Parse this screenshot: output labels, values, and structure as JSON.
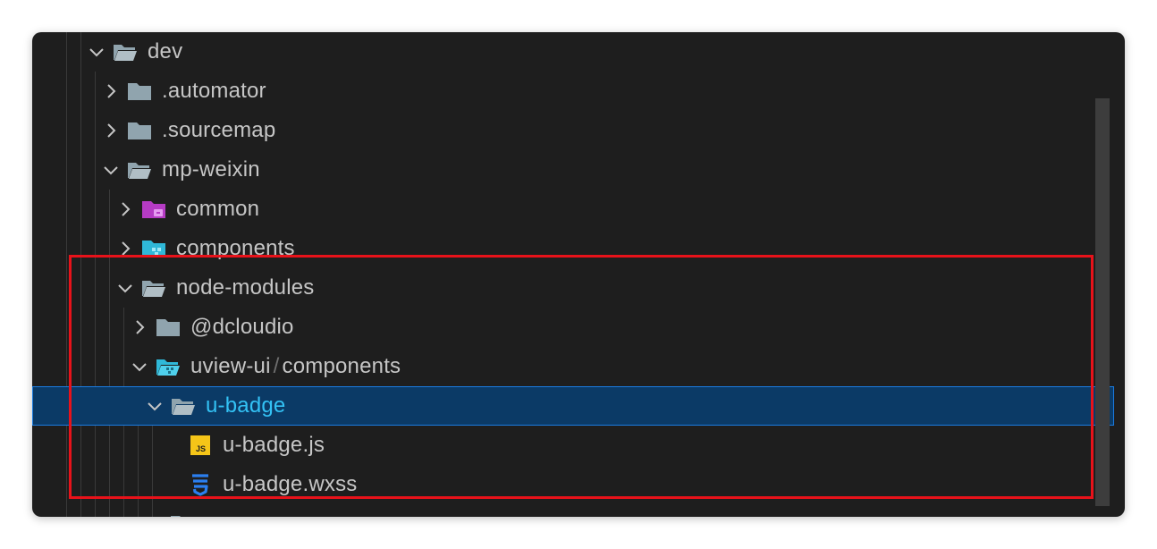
{
  "tree": {
    "items": [
      {
        "label": "dev",
        "expanded": true,
        "icon": "folder-open-icon"
      },
      {
        "label": ".automator",
        "expanded": false,
        "icon": "folder-icon"
      },
      {
        "label": ".sourcemap",
        "expanded": false,
        "icon": "folder-icon"
      },
      {
        "label": "mp-weixin",
        "expanded": true,
        "icon": "folder-open-icon"
      },
      {
        "label": "common",
        "expanded": false,
        "icon": "folder-common-icon"
      },
      {
        "label": "components",
        "expanded": false,
        "icon": "folder-components-icon"
      },
      {
        "label": "node-modules",
        "expanded": true,
        "icon": "folder-open-icon"
      },
      {
        "label": "@dcloudio",
        "expanded": false,
        "icon": "folder-icon"
      },
      {
        "label_part1": "uview-ui",
        "separator": "/",
        "label_part2": "components",
        "expanded": true,
        "icon": "folder-components-open-icon"
      },
      {
        "label": "u-badge",
        "expanded": true,
        "selected": true,
        "icon": "folder-open-icon"
      },
      {
        "label": "u-badge.js",
        "icon": "javascript-file-icon",
        "badge": "JS"
      },
      {
        "label": "u-badge.wxss",
        "icon": "css-file-icon"
      }
    ]
  },
  "colors": {
    "background": "#1e1e1e",
    "selection": "#0b3a66",
    "selection_border": "#1a7be0",
    "selected_text": "#33c2f5",
    "highlight_box": "#e8121a",
    "js_icon": "#f5c518",
    "css_icon": "#2b7ff0",
    "common_folder": "#c23ccf",
    "components_folder": "#2fb8d8"
  }
}
